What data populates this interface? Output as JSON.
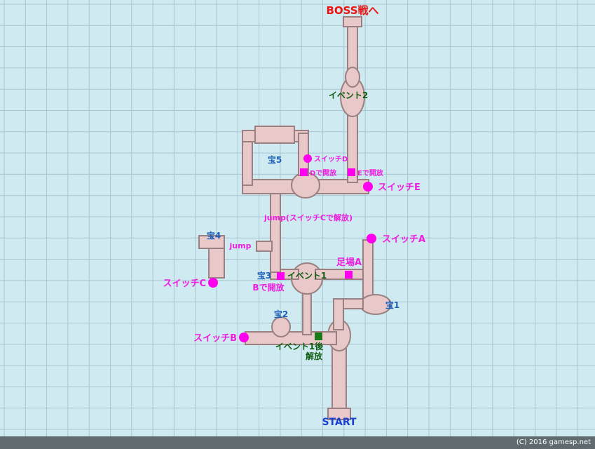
{
  "map": {
    "labels": {
      "boss": "BOSS戦へ",
      "event2": "イベント2",
      "treasure5": "宝5",
      "switch_d": "スイッチD",
      "d_open": "Dで開放",
      "e_open": "Eで開放",
      "switch_e": "スイッチE",
      "jump_c": "jump(スイッチCで解放)",
      "treasure4": "宝4",
      "jump": "jump",
      "switch_a": "スイッチA",
      "foothold_a": "足場A",
      "treasure3": "宝3",
      "event1": "イベント1",
      "b_open": "Bで開放",
      "switch_c": "スイッチC",
      "treasure1": "宝1",
      "treasure2": "宝2",
      "switch_b": "スイッチB",
      "event1_after_1": "イベント1後",
      "event1_after_2": "解放",
      "start": "START"
    },
    "credit": "(C) 2016 gamesp.net"
  },
  "colors": {
    "background": "#cfeaf1",
    "grid": "#a9c6d2",
    "path_fill": "#e8c8c8",
    "path_edge": "#9a8080",
    "switch_marker": "#ff00ee",
    "event_marker": "#1a7a1a",
    "boss_text": "#ee1111",
    "start_text": "#1b3fd1"
  }
}
